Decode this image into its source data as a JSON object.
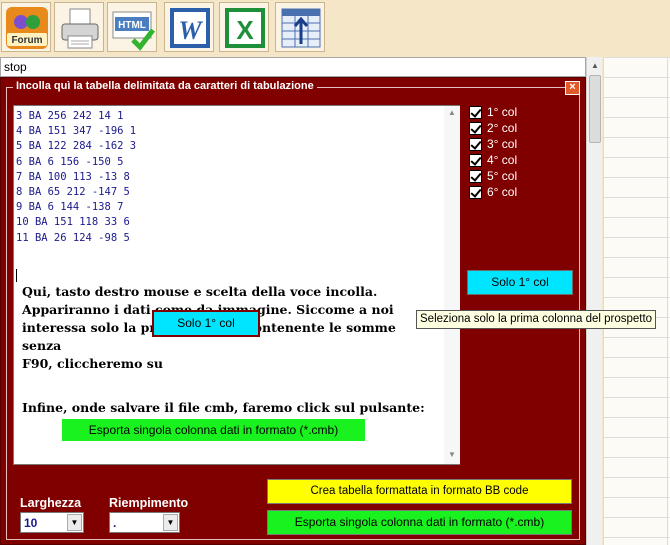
{
  "toolbar": {
    "buttons": [
      {
        "icon": "forum-icon",
        "label": "Forum"
      },
      {
        "icon": "printer-icon"
      },
      {
        "icon": "html-check-icon",
        "label": "HTML"
      },
      {
        "icon": "word-icon",
        "label": "W"
      },
      {
        "icon": "excel-icon",
        "label": "X"
      },
      {
        "icon": "table-arrow-icon"
      }
    ]
  },
  "stop_bar": {
    "label": "stop"
  },
  "dialog": {
    "title": "Incolla quì la tabella delimitata da caratteri di tabulazione",
    "close": "×",
    "textarea": {
      "rows": [
        "3 BA 256 242 14 1",
        "4 BA 151 347 -196 1",
        "5 BA 122 284 -162 3",
        "6 BA 6 156 -150 5",
        "7 BA 100 113 -13 8",
        "8 BA 65 212 -147 5",
        "9 BA 6 144 -138 7",
        "10 BA 151 118 33 6",
        "11 BA 26 124 -98 5"
      ],
      "instructions": [
        "Qui, tasto destro mouse e scelta della voce incolla.",
        "Appariranno i dati come da immagine. Siccome a noi",
        "interessa solo la prima colonna contenente le somme senza",
        "F90, cliccheremo su"
      ],
      "inline_solo_button": "Solo 1° col",
      "final_instruction": "Infine, onde salvare il file cmb, faremo click sul pulsante:",
      "inline_export_button": "Esporta singola colonna dati in formato (*.cmb)"
    },
    "columns": [
      {
        "label": "1° col",
        "checked": true
      },
      {
        "label": "2° col",
        "checked": true
      },
      {
        "label": "3° col",
        "checked": true
      },
      {
        "label": "4° col",
        "checked": true
      },
      {
        "label": "5° col",
        "checked": true
      },
      {
        "label": "6° col",
        "checked": true
      }
    ],
    "solo_button": "Solo 1° col",
    "tooltip": "Seleziona solo la prima colonna del prospetto",
    "larghezza": {
      "label": "Larghezza",
      "value": "10"
    },
    "riempimento": {
      "label": "Riempimento",
      "value": "."
    },
    "crea_button": "Crea tabella formattata in formato BB code",
    "export_button": "Esporta singola colonna dati in formato (*.cmb)"
  },
  "colors": {
    "dialog_bg": "#800000",
    "cyan_button": "#00e5ff",
    "green_button": "#19f21e",
    "yellow_button": "#ffff00",
    "host_bg": "#f5e6c8"
  }
}
